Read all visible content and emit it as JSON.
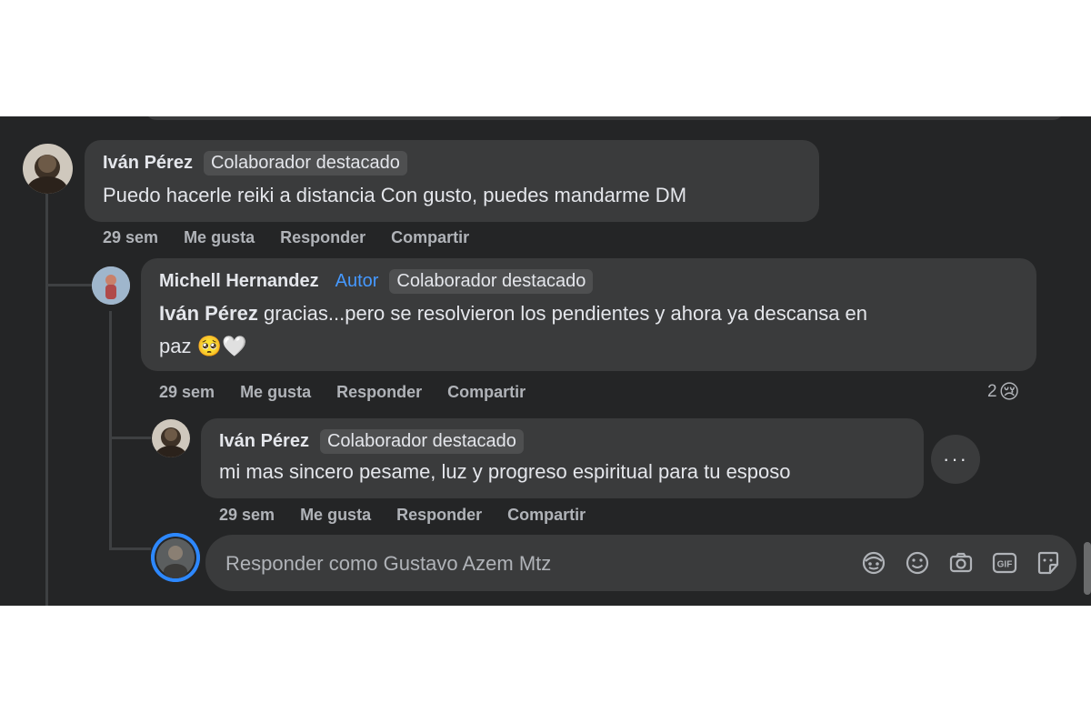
{
  "comment1": {
    "author": "Iván Pérez",
    "badge": "Colaborador destacado",
    "text": "Puedo hacerle reiki a distancia Con gusto, puedes mandarme DM",
    "time": "29 sem",
    "like": "Me gusta",
    "reply": "Responder",
    "share": "Compartir"
  },
  "reply1": {
    "author": "Michell Hernandez",
    "author_tag": "Autor",
    "badge": "Colaborador destacado",
    "mention": "Iván Pérez",
    "text": "gracias...pero se resolvieron los pendientes y ahora ya descansa en",
    "text_line2": "paz",
    "emoji": "🥺🤍",
    "time": "29 sem",
    "like": "Me gusta",
    "reply": "Responder",
    "share": "Compartir",
    "reaction_count": "2",
    "reaction_emoji": "😢"
  },
  "reply2": {
    "author": "Iván Pérez",
    "badge": "Colaborador destacado",
    "text": "mi mas sincero pesame, luz y progreso espiritual para tu esposo",
    "time": "29 sem",
    "like": "Me gusta",
    "reply": "Responder",
    "share": "Compartir",
    "more": "···"
  },
  "composer": {
    "placeholder": "Responder como Gustavo Azem Mtz",
    "tools": [
      "avatar-sticker-icon",
      "emoji-icon",
      "camera-icon",
      "gif-icon",
      "sticker-icon"
    ]
  },
  "colors": {
    "panel": "#242526",
    "bubble": "#3a3b3c",
    "text": "#e4e6eb",
    "muted": "#b0b3b8",
    "author_tag": "#4599ff"
  }
}
